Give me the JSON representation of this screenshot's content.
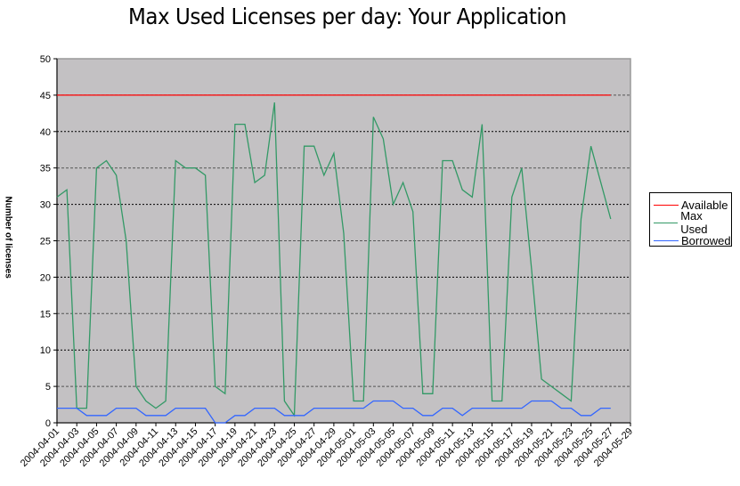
{
  "chart_data": {
    "type": "line",
    "title": "Max Used Licenses per day: Your Application",
    "xlabel": "",
    "ylabel": "Number of licenses",
    "ylim": [
      0,
      50
    ],
    "yticks": [
      0,
      5,
      10,
      15,
      20,
      25,
      30,
      35,
      40,
      45,
      50
    ],
    "grid": true,
    "legend_position": "right",
    "x_tick_labels": [
      "2004-04-01",
      "2004-04-03",
      "2004-04-05",
      "2004-04-07",
      "2004-04-09",
      "2004-04-11",
      "2004-04-13",
      "2004-04-15",
      "2004-04-17",
      "2004-04-19",
      "2004-04-21",
      "2004-04-23",
      "2004-04-25",
      "2004-04-27",
      "2004-04-29",
      "2004-05-01",
      "2004-05-03",
      "2004-05-05",
      "2004-05-07",
      "2004-05-09",
      "2004-05-11",
      "2004-05-13",
      "2004-05-15",
      "2004-05-17",
      "2004-05-19",
      "2004-05-21",
      "2004-05-23",
      "2004-05-25",
      "2004-05-27",
      "2004-05-29"
    ],
    "x_start": "2004-04-01",
    "x_days_total": 58,
    "series": [
      {
        "name": "Available",
        "color": "#ff0000",
        "values": [
          45,
          45,
          45,
          45,
          45,
          45,
          45,
          45,
          45,
          45,
          45,
          45,
          45,
          45,
          45,
          45,
          45,
          45,
          45,
          45,
          45,
          45,
          45,
          45,
          45,
          45,
          45,
          45,
          45,
          45,
          45,
          45,
          45,
          45,
          45,
          45,
          45,
          45,
          45,
          45,
          45,
          45,
          45,
          45,
          45,
          45,
          45,
          45,
          45,
          45,
          45,
          45,
          45,
          45,
          45,
          45,
          45
        ]
      },
      {
        "name": "Max Used",
        "color": "#339966",
        "values": [
          31,
          32,
          2,
          2,
          35,
          36,
          34,
          25,
          5,
          3,
          2,
          3,
          36,
          35,
          35,
          34,
          5,
          4,
          41,
          41,
          33,
          34,
          44,
          3,
          1,
          38,
          38,
          34,
          37,
          26,
          3,
          3,
          42,
          39,
          30,
          33,
          29,
          4,
          4,
          36,
          36,
          32,
          31,
          41,
          3,
          3,
          31,
          35,
          21,
          6,
          5,
          4,
          3,
          28,
          38,
          33,
          28
        ]
      },
      {
        "name": "Borrowed",
        "color": "#3366ff",
        "values": [
          2,
          2,
          2,
          1,
          1,
          1,
          2,
          2,
          2,
          1,
          1,
          1,
          2,
          2,
          2,
          2,
          0,
          0,
          1,
          1,
          2,
          2,
          2,
          1,
          1,
          1,
          2,
          2,
          2,
          2,
          2,
          2,
          3,
          3,
          3,
          2,
          2,
          1,
          1,
          2,
          2,
          1,
          2,
          2,
          2,
          2,
          2,
          2,
          3,
          3,
          3,
          2,
          2,
          1,
          1,
          2,
          2
        ]
      }
    ]
  }
}
